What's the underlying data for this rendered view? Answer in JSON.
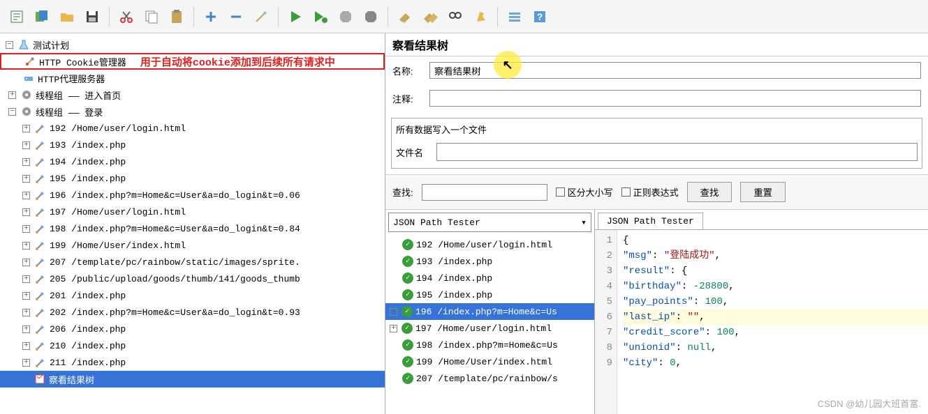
{
  "annotation": "用于自动将cookie添加到后续所有请求中",
  "tree": {
    "root": "测试计划",
    "cookie_mgr": "HTTP Cookie管理器",
    "proxy": "HTTP代理服务器",
    "tg1": "线程组 —— 进入首页",
    "tg2": "线程组 —— 登录",
    "items": [
      "192 /Home/user/login.html",
      "193 /index.php",
      "194 /index.php",
      "195 /index.php",
      "196 /index.php?m=Home&c=User&a=do_login&t=0.06",
      "197 /Home/user/login.html",
      "198 /index.php?m=Home&c=User&a=do_login&t=0.84",
      "199 /Home/User/index.html",
      "207 /template/pc/rainbow/static/images/sprite.",
      "205 /public/upload/goods/thumb/141/goods_thumb",
      "201 /index.php",
      "202 /index.php?m=Home&c=User&a=do_login&t=0.93",
      "206 /index.php",
      "210 /index.php",
      "211 /index.php"
    ],
    "view_results": "察看结果树"
  },
  "right": {
    "title": "察看结果树",
    "name_label": "名称:",
    "name_value": "察看结果树",
    "comment_label": "注释:",
    "file_section": "所有数据写入一个文件",
    "filename_label": "文件名",
    "search_label": "查找:",
    "case_sensitive": "区分大小写",
    "regex": "正则表达式",
    "search_btn": "查找",
    "reset_btn": "重置",
    "dropdown": "JSON Path Tester",
    "tab": "JSON Path Tester",
    "results": [
      "192 /Home/user/login.html",
      "193 /index.php",
      "194 /index.php",
      "195 /index.php",
      "196 /index.php?m=Home&c=Us",
      "197 /Home/user/login.html",
      "198 /index.php?m=Home&c=Us",
      "199 /Home/User/index.html",
      "207 /template/pc/rainbow/s"
    ],
    "selected_idx": 4
  },
  "chart_data": {
    "type": "json-text",
    "lines": [
      "{",
      "    \"msg\": \"登陆成功\",",
      "    \"result\": {",
      "        \"birthday\": -28800,",
      "        \"pay_points\": 100,",
      "        \"last_ip\": \"\",",
      "        \"credit_score\": 100,",
      "        \"unionid\": null,",
      "        \"city\": 0,"
    ],
    "highlight_line": 6
  },
  "watermark": "CSDN @幼儿园大班首富."
}
